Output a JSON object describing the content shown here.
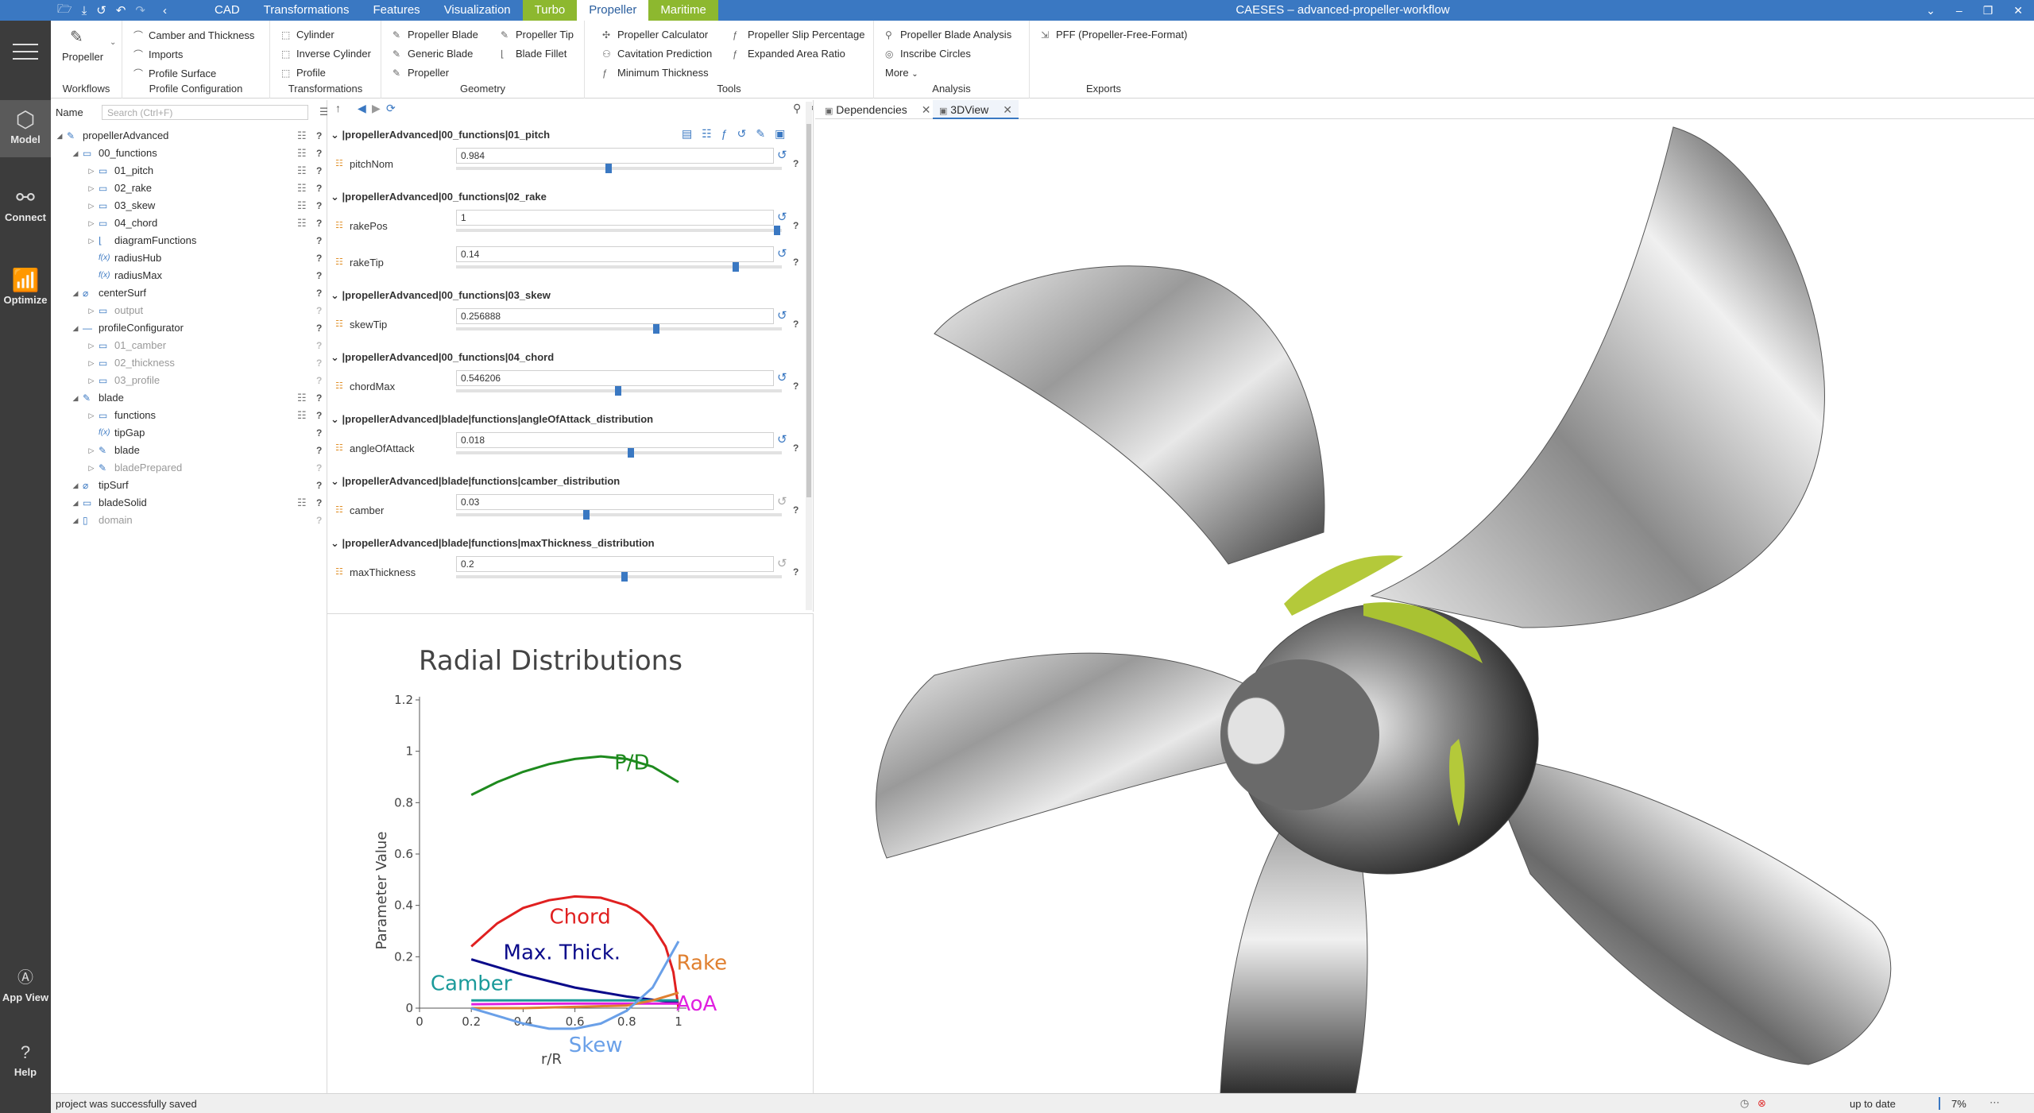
{
  "titlebar": {
    "quick_access": [
      "folder-open-icon",
      "save-icon",
      "history-icon",
      "undo-icon",
      "redo-icon",
      "back-icon"
    ],
    "menus": [
      "CAD",
      "Transformations",
      "Features",
      "Visualization",
      "Turbo",
      "Propeller",
      "Maritime"
    ],
    "window_title": "CAESES – advanced-propeller-workflow",
    "controls": [
      "chevron-down-icon",
      "minimize-icon",
      "restore-icon",
      "close-icon"
    ]
  },
  "leftnav": {
    "model": "Model",
    "connect": "Connect",
    "optimize": "Optimize",
    "app_view": "App View",
    "help": "Help"
  },
  "ribbon": {
    "workflows": {
      "label": "Workflows",
      "propeller": "Propeller"
    },
    "profile_config": {
      "label": "Profile Configuration",
      "items": [
        "Camber and Thickness",
        "Imports",
        "Profile Surface"
      ]
    },
    "transformations": {
      "label": "Transformations",
      "items": [
        "Cylinder",
        "Inverse Cylinder",
        "Profile"
      ]
    },
    "geometry": {
      "label": "Geometry",
      "col1": [
        "Propeller Blade",
        "Generic Blade",
        "Propeller"
      ],
      "col2": [
        "Propeller Tip",
        "Blade Fillet"
      ]
    },
    "tools": {
      "label": "Tools",
      "col1": [
        "Propeller Calculator",
        "Cavitation Prediction",
        "Minimum Thickness"
      ],
      "col2": [
        "Propeller Slip Percentage",
        "Expanded Area Ratio"
      ]
    },
    "analysis": {
      "label": "Analysis",
      "items": [
        "Propeller Blade Analysis",
        "Inscribe Circles",
        "More"
      ]
    },
    "exports": {
      "label": "Exports",
      "items": [
        "PFF (Propeller-Free-Format)"
      ]
    }
  },
  "tree": {
    "name_label": "Name",
    "search_placeholder": "Search (Ctrl+F)",
    "rows": [
      {
        "label": "propellerAdvanced",
        "level": 0,
        "icon": "feature-icon"
      },
      {
        "label": "00_functions",
        "level": 1,
        "icon": "folder-icon"
      },
      {
        "label": "01_pitch",
        "level": 2,
        "icon": "folder-icon"
      },
      {
        "label": "02_rake",
        "level": 2,
        "icon": "folder-icon"
      },
      {
        "label": "03_skew",
        "level": 2,
        "icon": "folder-icon"
      },
      {
        "label": "04_chord",
        "level": 2,
        "icon": "folder-icon"
      },
      {
        "label": "diagramFunctions",
        "level": 2,
        "icon": "chart-icon"
      },
      {
        "label": "radiusHub",
        "level": 2,
        "icon": "function-icon",
        "prefix": "f(x)"
      },
      {
        "label": "radiusMax",
        "level": 2,
        "icon": "function-icon",
        "prefix": "f(x)"
      },
      {
        "label": "centerSurf",
        "level": 1,
        "icon": "surface-icon"
      },
      {
        "label": "output",
        "level": 2,
        "icon": "folder-icon"
      },
      {
        "label": "profileConfigurator",
        "level": 1,
        "icon": "config-icon"
      },
      {
        "label": "01_camber",
        "level": 2,
        "icon": "folder-icon"
      },
      {
        "label": "02_thickness",
        "level": 2,
        "icon": "folder-icon"
      },
      {
        "label": "03_profile",
        "level": 2,
        "icon": "folder-icon"
      },
      {
        "label": "blade",
        "level": 1,
        "icon": "blade-icon"
      },
      {
        "label": "functions",
        "level": 2,
        "icon": "folder-icon"
      },
      {
        "label": "tipGap",
        "level": 2,
        "icon": "function-icon",
        "prefix": "f(x)"
      },
      {
        "label": "blade",
        "level": 2,
        "icon": "blade-icon"
      },
      {
        "label": "bladePrepared",
        "level": 2,
        "icon": "blade-icon"
      },
      {
        "label": "tipSurf",
        "level": 1,
        "icon": "surface-icon"
      },
      {
        "label": "bladeSolid",
        "level": 1,
        "icon": "solid-icon"
      },
      {
        "label": "domain",
        "level": 1,
        "icon": "domain-icon"
      }
    ]
  },
  "params": {
    "sections": [
      {
        "title": "|propellerAdvanced|00_functions|01_pitch",
        "params": [
          {
            "name": "pitchNom",
            "value": "0.984",
            "pos": 0.47,
            "dim": false
          }
        ]
      },
      {
        "title": "|propellerAdvanced|00_functions|02_rake",
        "params": [
          {
            "name": "rakePos",
            "value": "1",
            "pos": 1.0,
            "dim": false
          },
          {
            "name": "rakeTip",
            "value": "0.14",
            "pos": 0.87,
            "dim": false
          }
        ]
      },
      {
        "title": "|propellerAdvanced|00_functions|03_skew",
        "params": [
          {
            "name": "skewTip",
            "value": "0.256888",
            "pos": 0.62,
            "dim": false
          }
        ]
      },
      {
        "title": "|propellerAdvanced|00_functions|04_chord",
        "params": [
          {
            "name": "chordMax",
            "value": "0.546206",
            "pos": 0.5,
            "dim": false
          }
        ]
      },
      {
        "title": "|propellerAdvanced|blade|functions|angleOfAttack_distribution",
        "params": [
          {
            "name": "angleOfAttack",
            "value": "0.018",
            "pos": 0.54,
            "dim": false
          }
        ]
      },
      {
        "title": "|propellerAdvanced|blade|functions|camber_distribution",
        "params": [
          {
            "name": "camber",
            "value": "0.03",
            "pos": 0.4,
            "dim": true
          }
        ]
      },
      {
        "title": "|propellerAdvanced|blade|functions|maxThickness_distribution",
        "params": [
          {
            "name": "maxThickness",
            "value": "0.2",
            "pos": 0.52,
            "dim": true
          }
        ]
      }
    ]
  },
  "chart_data": {
    "type": "line",
    "title": "Radial Distributions",
    "xlabel": "r/R",
    "ylabel": "Parameter Value",
    "xlim": [
      0,
      1
    ],
    "ylim": [
      0,
      1.2
    ],
    "xticks": [
      "0",
      "0.2",
      "0.4",
      "0.6",
      "0.8",
      "1"
    ],
    "yticks": [
      "0",
      "0.2",
      "0.4",
      "0.6",
      "0.8",
      "1",
      "1.2"
    ],
    "series": [
      {
        "name": "P/D",
        "color": "#1e8a1e",
        "x": [
          0.2,
          0.3,
          0.4,
          0.5,
          0.6,
          0.7,
          0.8,
          0.9,
          1.0
        ],
        "y": [
          0.83,
          0.88,
          0.92,
          0.95,
          0.97,
          0.98,
          0.97,
          0.94,
          0.88
        ]
      },
      {
        "name": "Chord",
        "color": "#e02020",
        "x": [
          0.2,
          0.3,
          0.4,
          0.5,
          0.6,
          0.7,
          0.8,
          0.85,
          0.9,
          0.95,
          0.98,
          1.0
        ],
        "y": [
          0.24,
          0.33,
          0.39,
          0.42,
          0.435,
          0.43,
          0.4,
          0.37,
          0.32,
          0.24,
          0.14,
          0.0
        ]
      },
      {
        "name": "Max. Thick.",
        "color": "#0a0a8a",
        "x": [
          0.2,
          0.4,
          0.6,
          0.8,
          1.0
        ],
        "y": [
          0.19,
          0.13,
          0.08,
          0.045,
          0.02
        ]
      },
      {
        "name": "Camber",
        "color": "#1a9a9a",
        "x": [
          0.2,
          0.4,
          0.6,
          0.8,
          1.0
        ],
        "y": [
          0.03,
          0.03,
          0.03,
          0.03,
          0.03
        ]
      },
      {
        "name": "AoA",
        "color": "#e020e0",
        "x": [
          0.2,
          0.4,
          0.6,
          0.8,
          1.0
        ],
        "y": [
          0.015,
          0.017,
          0.018,
          0.018,
          0.018
        ]
      },
      {
        "name": "Rake",
        "color": "#e08030",
        "x": [
          0.2,
          0.4,
          0.6,
          0.8,
          0.9,
          1.0
        ],
        "y": [
          0.0,
          0.0,
          0.005,
          0.01,
          0.03,
          0.06
        ]
      },
      {
        "name": "Skew",
        "color": "#6aa0e8",
        "x": [
          0.2,
          0.3,
          0.4,
          0.5,
          0.6,
          0.7,
          0.8,
          0.9,
          1.0
        ],
        "y": [
          0.0,
          -0.03,
          -0.06,
          -0.08,
          -0.08,
          -0.06,
          -0.01,
          0.08,
          0.26
        ]
      }
    ],
    "series_label_colors": {
      "Rake": "#e08030"
    }
  },
  "view_tabs": [
    "Dependencies",
    "3DView"
  ],
  "status": {
    "message": "project was successfully saved",
    "state": "up to date",
    "zoom": "7%"
  }
}
